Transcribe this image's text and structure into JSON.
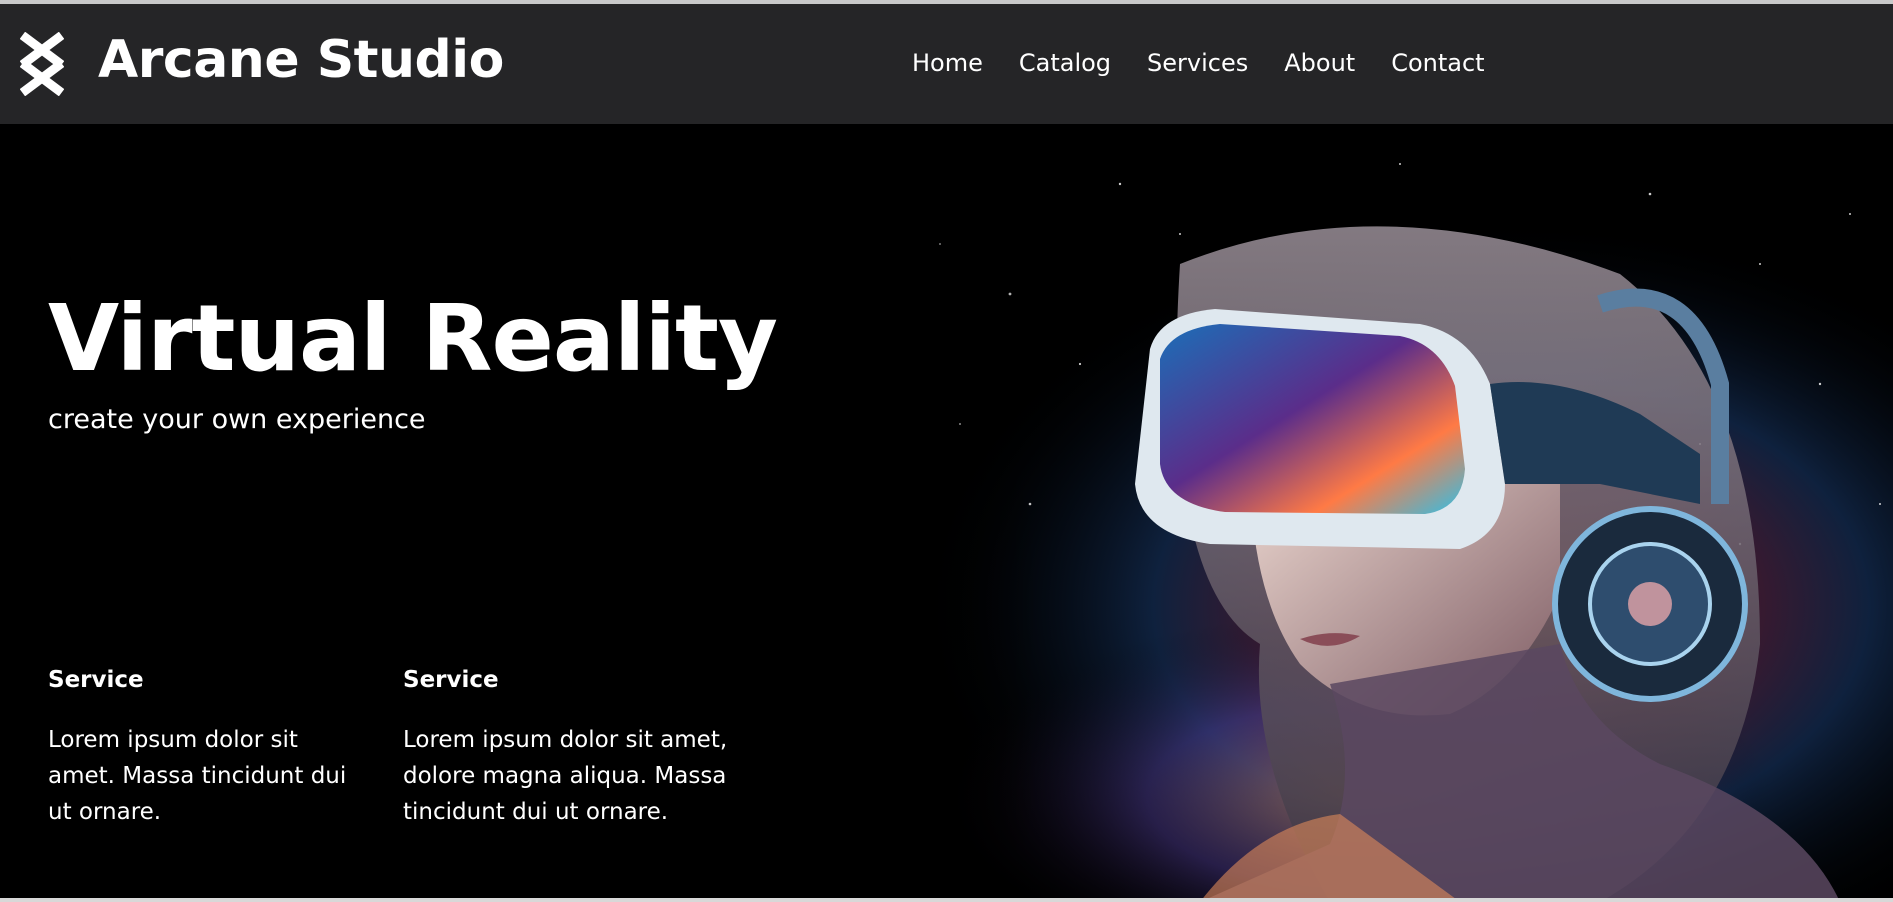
{
  "header": {
    "logo_icon": "arcane-x-logo-icon",
    "brand": "Arcane Studio",
    "nav": [
      "Home",
      "Catalog",
      "Services",
      "About",
      "Contact"
    ]
  },
  "hero": {
    "title": "Virtual Reality",
    "subtitle": "create your own experience",
    "services": [
      {
        "title": "Service",
        "text": "Lorem ipsum dolor sit amet. Massa tincidunt dui ut ornare."
      },
      {
        "title": "Service",
        "text": "Lorem ipsum dolor sit amet, dolore magna aliqua. Massa tincidunt dui ut ornare."
      }
    ],
    "image": "vr-headset-woman-cosmic-image"
  },
  "colors": {
    "header_bg": "#252527",
    "page_bg": "#000000",
    "text": "#ffffff"
  }
}
